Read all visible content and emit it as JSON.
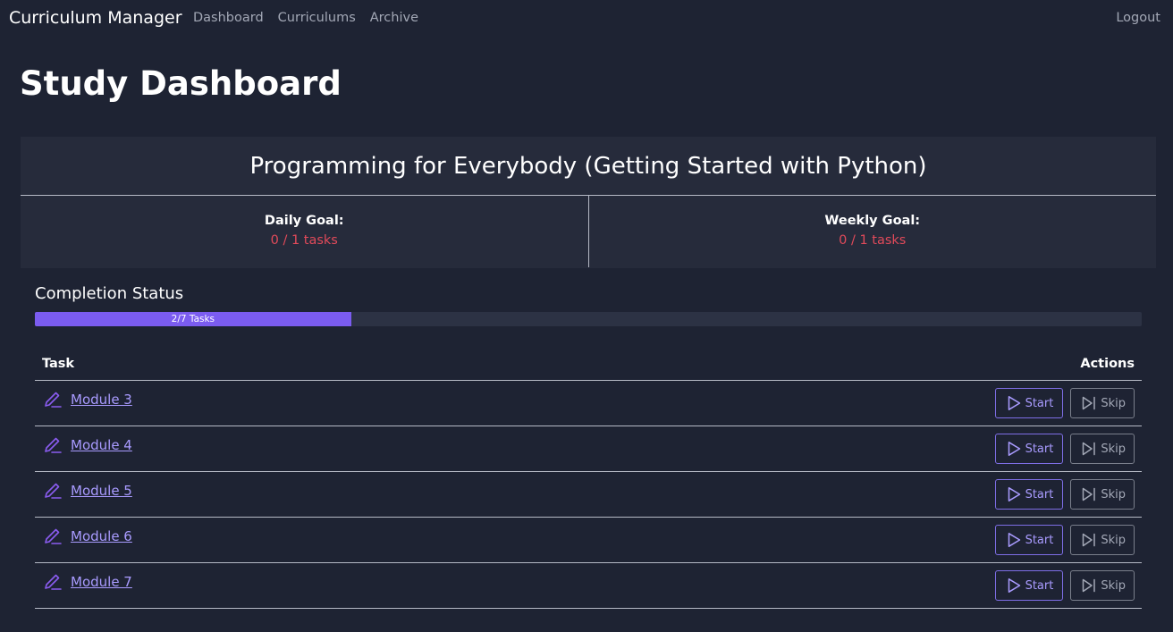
{
  "nav": {
    "brand": "Curriculum Manager",
    "links": [
      "Dashboard",
      "Curriculums",
      "Archive"
    ],
    "logout": "Logout"
  },
  "page": {
    "title": "Study Dashboard"
  },
  "curriculum": {
    "title": "Programming for Everybody (Getting Started with Python)",
    "daily_goal": {
      "label": "Daily Goal:",
      "value": "0 / 1 tasks"
    },
    "weekly_goal": {
      "label": "Weekly Goal:",
      "value": "0 / 1 tasks"
    }
  },
  "completion": {
    "title": "Completion Status",
    "progress_label": "2/7 Tasks",
    "completed": 2,
    "total": 7
  },
  "table": {
    "headers": {
      "task": "Task",
      "actions": "Actions"
    },
    "rows": [
      {
        "task": "Module 3",
        "start": "Start",
        "skip": "Skip"
      },
      {
        "task": "Module 4",
        "start": "Start",
        "skip": "Skip"
      },
      {
        "task": "Module 5",
        "start": "Start",
        "skip": "Skip"
      },
      {
        "task": "Module 6",
        "start": "Start",
        "skip": "Skip"
      },
      {
        "task": "Module 7",
        "start": "Start",
        "skip": "Skip"
      }
    ]
  },
  "icons": {
    "task": "pencil-icon",
    "start": "play-icon",
    "skip": "skip-forward-icon"
  },
  "colors": {
    "background": "#1e2333",
    "card": "#262b3b",
    "accent": "#7b5cf0",
    "link": "#a99bff",
    "goal_value": "#e14a5a"
  }
}
